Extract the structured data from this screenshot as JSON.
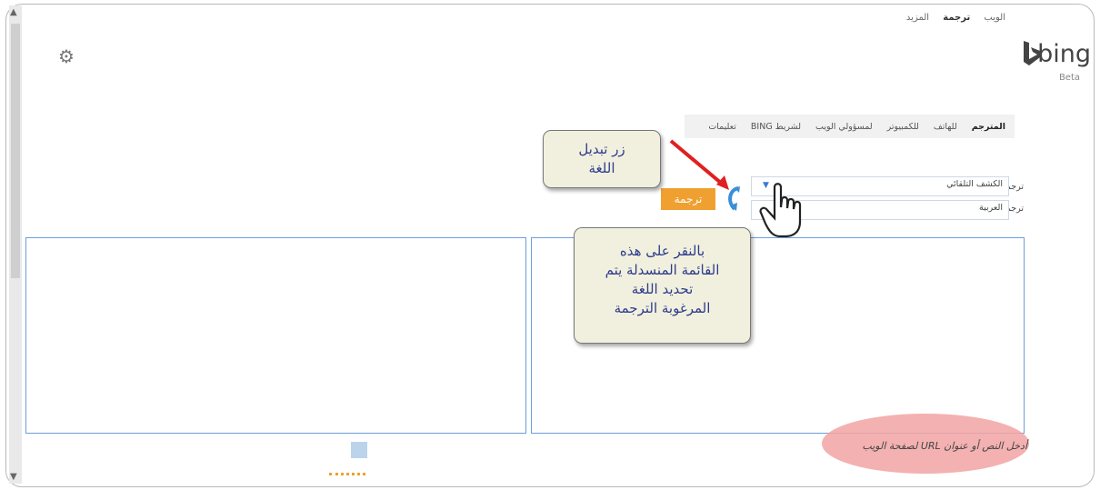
{
  "topnav": {
    "items": [
      "الويب",
      "ترجمة",
      "المزيد"
    ],
    "active": "ترجمة"
  },
  "brand": {
    "name": "bing",
    "badge": "Beta",
    "logo_color": "#00809d"
  },
  "tabs": [
    {
      "label": "المترجم",
      "active": true
    },
    {
      "label": "للهاتف"
    },
    {
      "label": "للكمبيوتر"
    },
    {
      "label": "لمسؤولي الويب"
    },
    {
      "label": "لشريط BING"
    },
    {
      "label": "تعليمات"
    }
  ],
  "form": {
    "from_label": "ترجمة من:",
    "from_value": "الكشف التلقائي",
    "to_label": "ترجمة إلى:",
    "to_value": "العربية",
    "translate_button": "ترجمة"
  },
  "callouts": {
    "swap": [
      "زر تبديل",
      "اللغة"
    ],
    "dropdown": [
      "بالنقر على هذه",
      "القائمة المنسدلة يتم",
      "تحديد اللغة",
      "المرغوبة الترجمة"
    ]
  },
  "hint": "أدخل النص أو عنوان URL لصفحة الويب",
  "icons": [
    "gear-icon",
    "swap-language-icon",
    "hand-cursor-icon",
    "dropdown-arrow-icon",
    "bing-logo-icon"
  ],
  "colors": {
    "translate_button": "#f0a030",
    "callout_text": "#2d3b8c",
    "arrow": "#e02020",
    "highlight": "#f2a3a3"
  }
}
